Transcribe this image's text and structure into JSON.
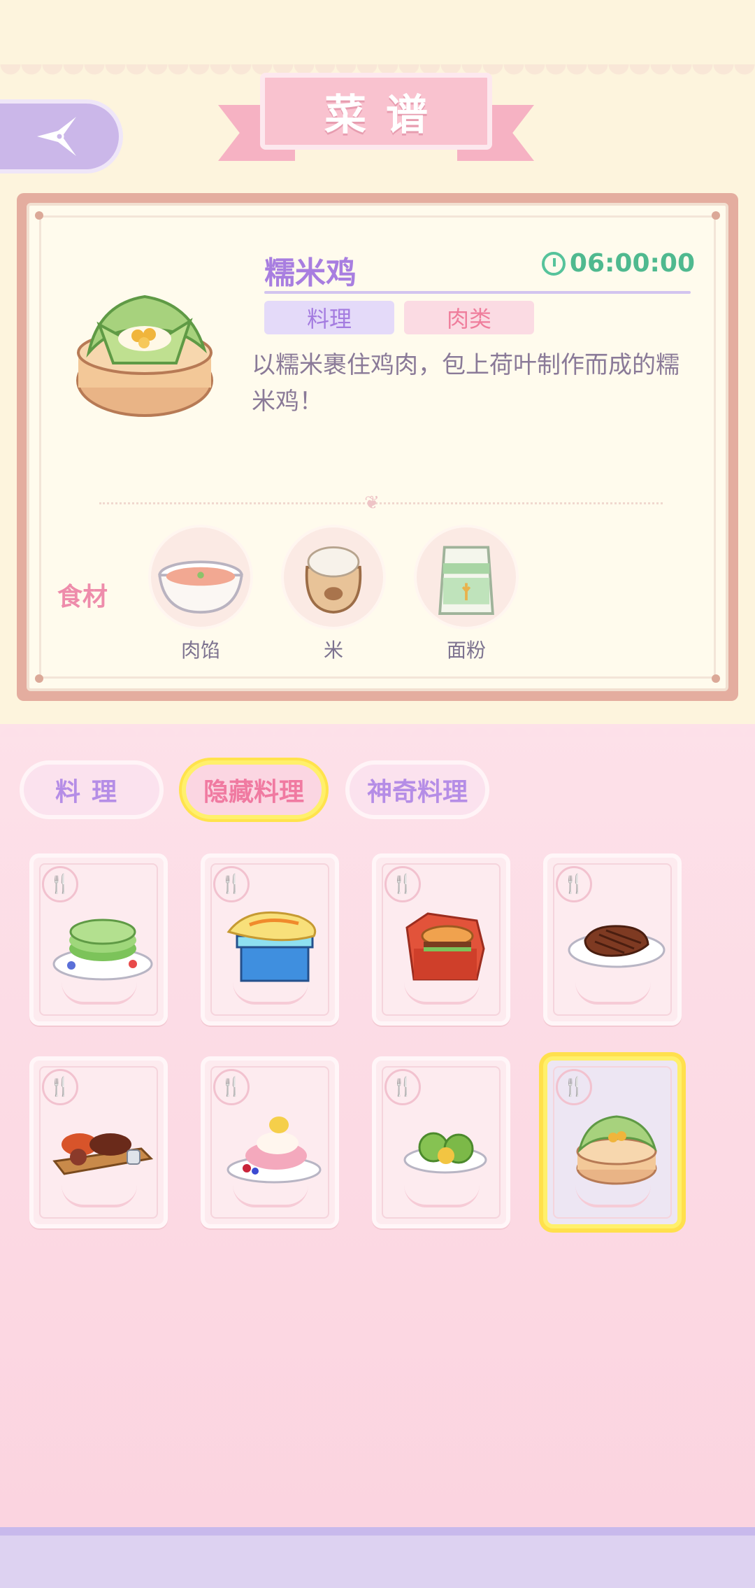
{
  "header": {
    "title": "菜谱",
    "back_icon": "compass-back-icon"
  },
  "detail": {
    "name": "糯米鸡",
    "timer": "06:00:00",
    "tags": [
      "料理",
      "肉类"
    ],
    "description": "以糯米裹住鸡肉，包上荷叶制作而成的糯米鸡！",
    "ingredients_label": "食材",
    "ingredients": [
      {
        "name": "肉馅",
        "icon": "meat-filling-bowl-icon"
      },
      {
        "name": "米",
        "icon": "rice-sack-icon"
      },
      {
        "name": "面粉",
        "icon": "flour-bag-icon"
      }
    ]
  },
  "tabs": [
    {
      "label": "料理",
      "active": false
    },
    {
      "label": "隐藏料理",
      "active": true
    },
    {
      "label": "神奇料理",
      "active": false
    }
  ],
  "recipes": [
    {
      "icon": "green-pancake-dish-icon",
      "selected": false
    },
    {
      "icon": "omelette-cooler-dish-icon",
      "selected": false
    },
    {
      "icon": "burger-box-dish-icon",
      "selected": false
    },
    {
      "icon": "steak-dish-icon",
      "selected": false
    },
    {
      "icon": "grilled-platter-dish-icon",
      "selected": false
    },
    {
      "icon": "pink-dessert-dish-icon",
      "selected": false
    },
    {
      "icon": "green-dumplings-dish-icon",
      "selected": false
    },
    {
      "icon": "lotus-leaf-rice-dish-icon",
      "selected": true
    }
  ],
  "colors": {
    "accent_purple": "#a87ee0",
    "accent_pink": "#ef7e9c",
    "timer_green": "#4fb98f",
    "highlight_yellow": "#ffe04c"
  }
}
